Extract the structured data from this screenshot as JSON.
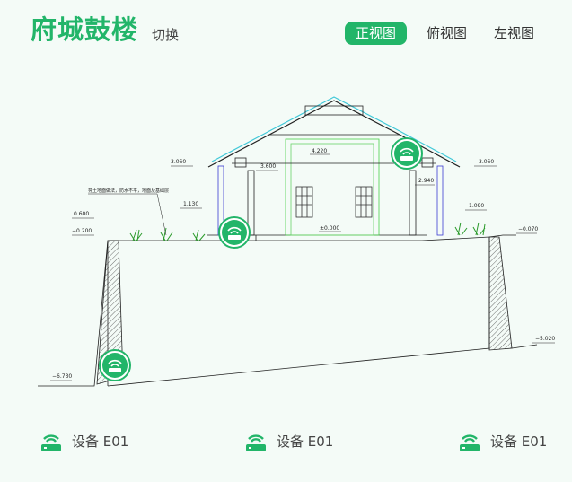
{
  "header": {
    "title": "府城鼓楼",
    "switch_label": "切换",
    "tabs": [
      {
        "label": "正视图",
        "active": true
      },
      {
        "label": "俯视图",
        "active": false
      },
      {
        "label": "左视图",
        "active": false
      }
    ]
  },
  "drawing": {
    "elevations": {
      "left_eave": "3.060",
      "right_eave": "3.060",
      "ridge": "4.220",
      "left_inner": "3.600",
      "right_inner": "2.940",
      "left_step": "1.130",
      "right_step": "1.090",
      "left_wall": "0.600",
      "left_ground": "−0.200",
      "floor": "±0.000",
      "right_ground": "−0.070",
      "right_bottom": "−5.020",
      "left_bottom": "−6.730"
    },
    "note": "夯土地面做法，防水不平，地面及基础层"
  },
  "devices": [
    {
      "label": "设备 E01"
    },
    {
      "label": "设备 E01"
    },
    {
      "label": "设备 E01"
    }
  ],
  "colors": {
    "accent": "#22b569",
    "background": "#f4fbf7"
  }
}
